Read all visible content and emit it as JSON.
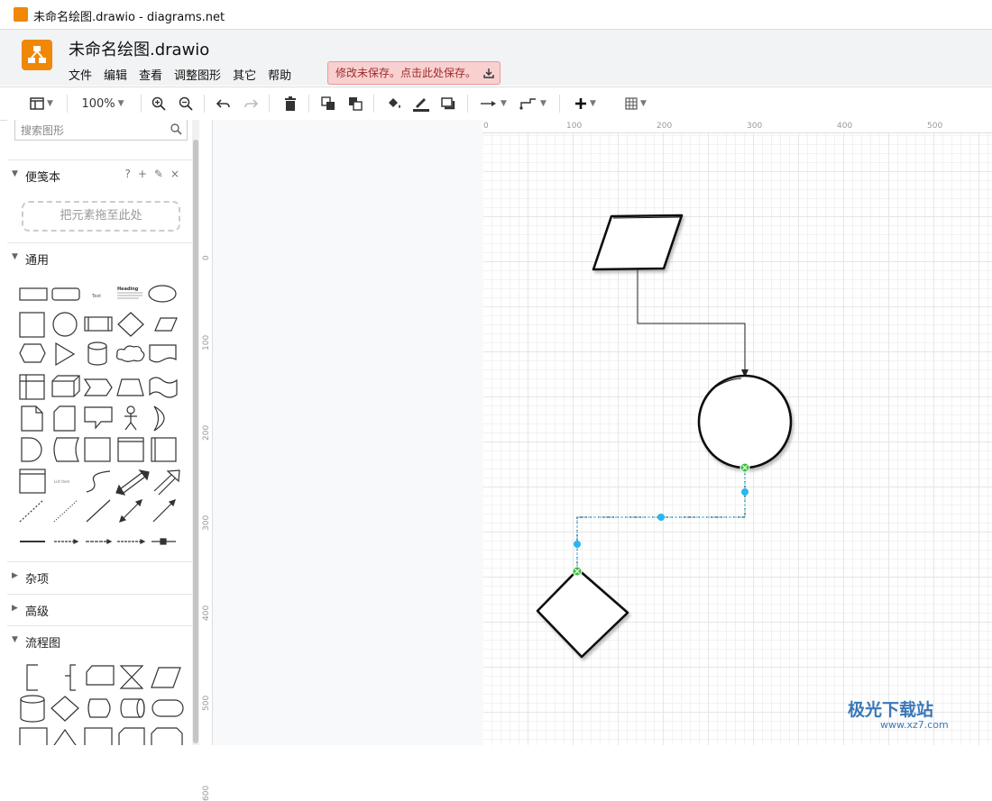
{
  "window": {
    "title": "未命名绘图.drawio - diagrams.net"
  },
  "header": {
    "filename": "未命名绘图.drawio",
    "menu": [
      "文件",
      "编辑",
      "查看",
      "调整图形",
      "其它",
      "帮助"
    ],
    "unsaved_notice": "修改未保存。点击此处保存。"
  },
  "toolbar": {
    "zoom": "100%",
    "icons": [
      "format-panel-icon",
      "zoom-in-icon",
      "zoom-out-icon",
      "undo-icon",
      "redo-icon",
      "delete-icon",
      "to-front-icon",
      "to-back-icon",
      "fill-color-icon",
      "line-color-icon",
      "shadow-icon",
      "connection-icon",
      "waypoints-icon",
      "insert-icon",
      "table-icon"
    ]
  },
  "sidebar": {
    "search_placeholder": "搜索图形",
    "sections": {
      "scratchpad": {
        "label": "便笺本",
        "tools": [
          "?",
          "+",
          "✎",
          "×"
        ],
        "dropzone": "把元素拖至此处"
      },
      "general": {
        "label": "通用"
      },
      "misc": {
        "label": "杂项"
      },
      "advanced": {
        "label": "高级"
      },
      "flowchart": {
        "label": "流程图"
      }
    },
    "shape_texts": {
      "text": "Text",
      "heading": "Heading",
      "list": "List Item"
    }
  },
  "ruler": {
    "top": [
      "0",
      "100",
      "200",
      "300",
      "400",
      "500"
    ],
    "left": [
      "0",
      "100",
      "200",
      "300",
      "400",
      "500",
      "600"
    ]
  },
  "diagram": {
    "shapes": [
      "parallelogram",
      "circle",
      "diamond"
    ],
    "selected_edge": "circle-to-diamond"
  },
  "watermark": {
    "brand": "极光下载站",
    "url": "www.xz7.com"
  },
  "colors": {
    "accent": "#f08705",
    "selection": "#29b6f2",
    "unsaved_bg": "#f8d0d0",
    "unsaved_text": "#a12b2b"
  }
}
